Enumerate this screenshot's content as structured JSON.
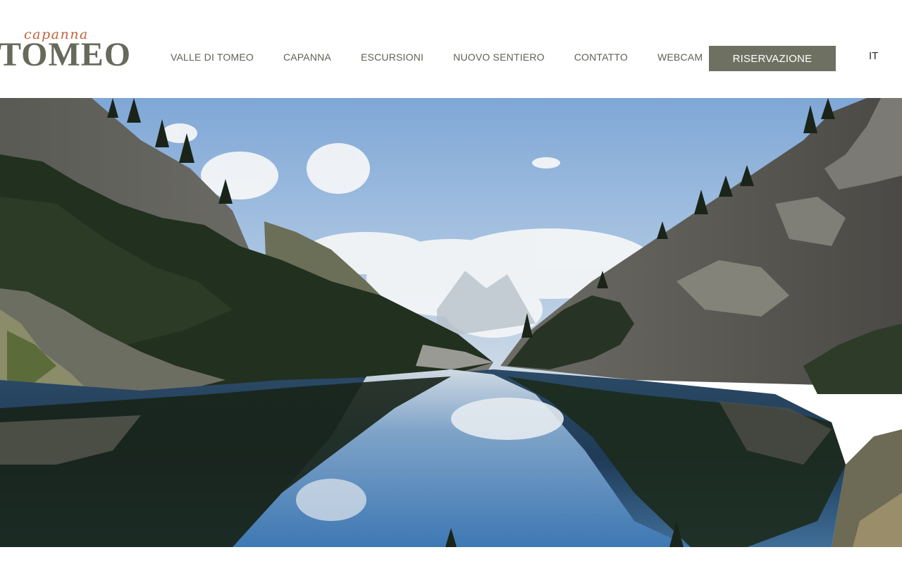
{
  "logo": {
    "script": "capanna",
    "main": "TOMEO"
  },
  "nav": {
    "items": [
      {
        "label": "VALLE DI TOMEO"
      },
      {
        "label": "CAPANNA"
      },
      {
        "label": "ESCURSIONI"
      },
      {
        "label": "NUOVO SENTIERO"
      },
      {
        "label": "CONTATTO"
      },
      {
        "label": "WEBCAM"
      }
    ]
  },
  "reserve_button": "RISERVAZIONE",
  "language": "IT",
  "colors": {
    "brand_olive": "#6e7161",
    "logo_accent": "#c4603b",
    "nav_text": "#5f6255"
  },
  "hero": {
    "icon": "mountain-lake-photo"
  }
}
